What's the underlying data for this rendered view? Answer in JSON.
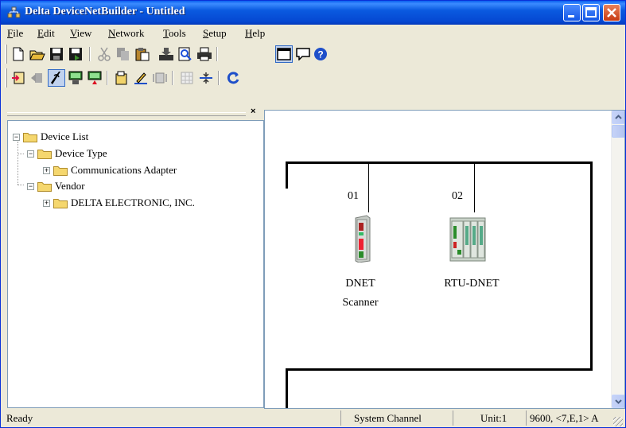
{
  "window": {
    "title": "Delta DeviceNetBuilder - Untitled"
  },
  "menu": [
    "File",
    "Edit",
    "View",
    "Network",
    "Tools",
    "Setup",
    "Help"
  ],
  "toolbar1": {
    "icons": [
      "new-file-icon",
      "open-folder-icon",
      "save-icon",
      "save-as-icon",
      "cut-icon",
      "copy-icon",
      "paste-icon",
      "download-icon",
      "print-preview-icon",
      "print-icon",
      "view-window-icon",
      "message-icon",
      "help-icon"
    ]
  },
  "toolbar2": {
    "icons": [
      "online-icon",
      "offline-icon",
      "scan-icon",
      "upload-network-icon",
      "download-network-icon",
      "read-config-icon",
      "edit-config-icon",
      "diagnostic-icon",
      "grid-icon",
      "connect-icon",
      "refresh-icon"
    ]
  },
  "tree": {
    "root": "Device List",
    "device_type": "Device Type",
    "comms_adapter": "Communications Adapter",
    "vendor": "Vendor",
    "delta": "DELTA ELECTRONIC, INC."
  },
  "network": {
    "nodes": [
      {
        "address": "01",
        "name_line1": "DNET",
        "name_line2": "Scanner"
      },
      {
        "address": "02",
        "name_line1": "RTU-DNET",
        "name_line2": ""
      }
    ]
  },
  "status": {
    "ready": "Ready",
    "channel": "System Channel",
    "unit": "Unit:1",
    "comm": "9600, <7,E,1> A"
  },
  "colors": {
    "titlebar": "#0a5ae0",
    "folder": "#f5d76e",
    "bus": "#000000"
  }
}
